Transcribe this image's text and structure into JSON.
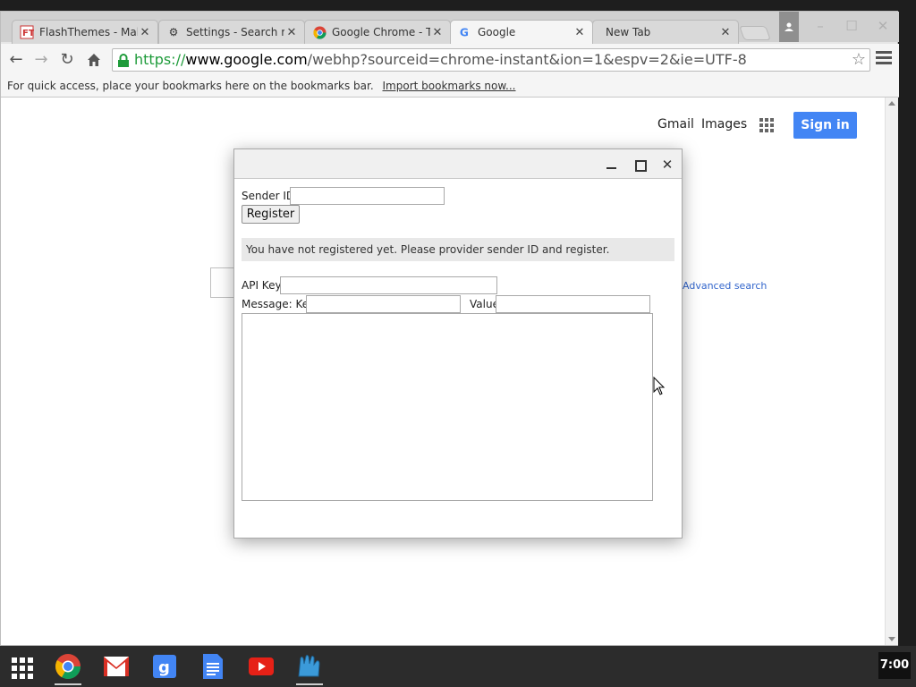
{
  "browser": {
    "tabs": [
      {
        "title": "FlashThemes - Make",
        "icon": "flashthemes-icon"
      },
      {
        "title": "Settings - Search res",
        "icon": "gear-icon"
      },
      {
        "title": "Google Chrome - Th",
        "icon": "chrome-icon"
      },
      {
        "title": "Google",
        "icon": "google-g-icon",
        "active": true
      },
      {
        "title": "New Tab",
        "icon": ""
      }
    ],
    "url": {
      "scheme": "https://",
      "host": "www.google.com",
      "path": "/webhp?sourceid=chrome-instant&ion=1&espv=2&ie=UTF-8"
    },
    "bookmarks_bar": {
      "message": "For quick access, place your bookmarks here on the bookmarks bar.",
      "import_link": "Import bookmarks now..."
    }
  },
  "google_page": {
    "gmail": "Gmail",
    "images": "Images",
    "sign_in": "Sign in",
    "advanced_search": "Advanced search"
  },
  "dialog": {
    "sender_id_label": "Sender ID:",
    "sender_id_value": "",
    "register_label": "Register",
    "status_message": "You have not registered yet. Please provider sender ID and register.",
    "api_key_label": "API Key:",
    "api_key_value": "",
    "message_key_label": "Message: Key",
    "message_key_value": "",
    "value_label": "Value",
    "value_value": "",
    "message_body": ""
  },
  "shelf": {
    "apps": [
      "chrome-icon",
      "gmail-icon",
      "google-search-icon",
      "docs-icon",
      "youtube-icon",
      "app-icon"
    ],
    "clock": "7:00"
  },
  "colors": {
    "accent_blue": "#4285f4",
    "url_green": "#1e9b3a",
    "link_blue": "#3366cc"
  }
}
